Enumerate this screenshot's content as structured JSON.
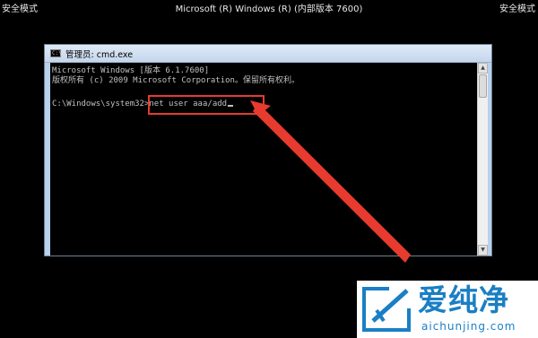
{
  "desktop": {
    "safe_mode_left": "安全模式",
    "safe_mode_right": "安全模式",
    "title": "Microsoft (R) Windows (R) (内部版本 7600)"
  },
  "window": {
    "title": "管理员: cmd.exe",
    "icon_text": "C:\\"
  },
  "console": {
    "line1": "Microsoft Windows [版本 6.1.7600]",
    "line2": "版权所有 (c) 2009 Microsoft Corporation。保留所有权利。",
    "prompt": "C:\\Windows\\system32>",
    "command": "net user aaa/add"
  },
  "scrollbar": {
    "up": "▲",
    "down": "▼"
  },
  "watermark": {
    "brand": "爱纯净",
    "url": "aichunjing.com"
  },
  "annotation": {
    "color": "#e63b2e"
  }
}
